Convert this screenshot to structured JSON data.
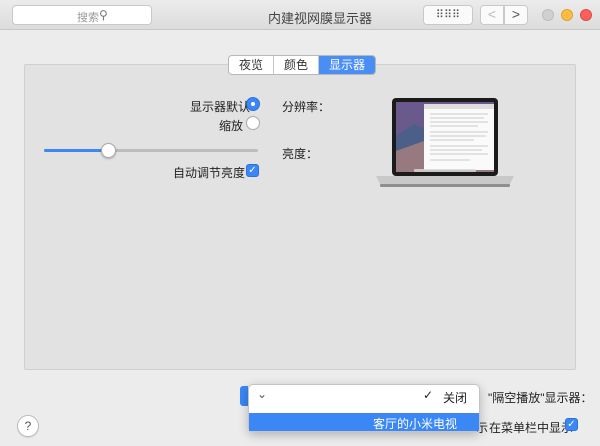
{
  "window": {
    "title": "内建视网膜显示器",
    "grid_glyph": "⠿⠿⠿",
    "nav_back": "<",
    "nav_forward": ">"
  },
  "search": {
    "placeholder": "搜索",
    "icon": "magnifier-icon"
  },
  "tabs": [
    {
      "label": "夜览",
      "active": false
    },
    {
      "label": "颜色",
      "active": false
    },
    {
      "label": "显示器",
      "active": true
    }
  ],
  "resolution": {
    "label": "分辨率：",
    "options": [
      {
        "label": "显示器默认",
        "selected": true
      },
      {
        "label": "缩放",
        "selected": false
      }
    ]
  },
  "brightness": {
    "label": "亮度：",
    "level_percent": 30,
    "auto_label": "自动调节亮度",
    "auto_checked": true
  },
  "airplay": {
    "label": "\"隔空播放\"显示器：",
    "options": [
      {
        "label": "关闭",
        "checked": true
      },
      {
        "label": "客厅的小米电视",
        "highlighted": true
      }
    ]
  },
  "menubar": {
    "label": "在菜单栏中显示",
    "visible_fragment": "示",
    "checked": true
  },
  "help": {
    "label": "?"
  },
  "colors": {
    "accent": "#3a87f5",
    "traffic_red": "#fc605c",
    "traffic_yellow": "#fdbc40"
  }
}
